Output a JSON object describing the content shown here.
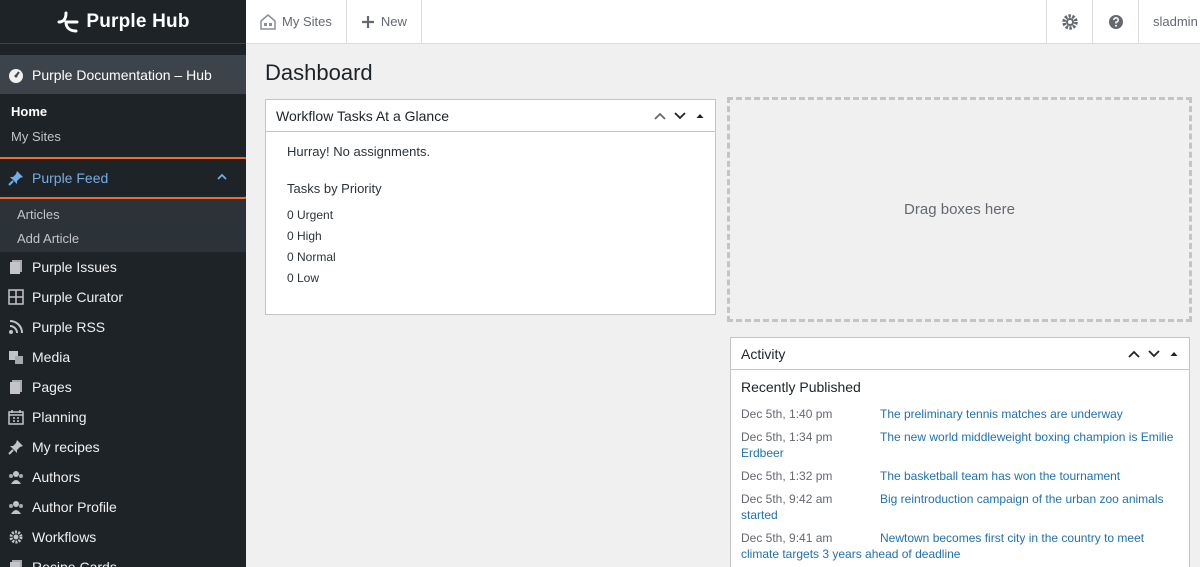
{
  "brand": {
    "name": "Purple Hub"
  },
  "sidebar": {
    "site_label": "Purple Documentation – Hub",
    "site_links": [
      {
        "label": "Home"
      },
      {
        "label": "My Sites"
      }
    ],
    "active_menu": {
      "label": "Purple Feed",
      "icon": "pin-icon"
    },
    "active_submenu": [
      {
        "label": "Articles"
      },
      {
        "label": "Add Article"
      }
    ],
    "items": [
      {
        "label": "Purple Issues",
        "icon": "issues-icon"
      },
      {
        "label": "Purple Curator",
        "icon": "curator-icon"
      },
      {
        "label": "Purple RSS",
        "icon": "rss-icon"
      },
      {
        "label": "Media",
        "icon": "media-icon"
      },
      {
        "label": "Pages",
        "icon": "pages-icon"
      },
      {
        "label": "Planning",
        "icon": "calendar-icon"
      },
      {
        "label": "My recipes",
        "icon": "pin-icon"
      },
      {
        "label": "Authors",
        "icon": "users-icon"
      },
      {
        "label": "Author Profile",
        "icon": "users-icon"
      },
      {
        "label": "Workflows",
        "icon": "gear-icon"
      },
      {
        "label": "Recipe Cards",
        "icon": "pages-icon"
      }
    ]
  },
  "topbar": {
    "my_sites": "My Sites",
    "new": "New",
    "user": "sladmin"
  },
  "page": {
    "title": "Dashboard"
  },
  "workflow_panel": {
    "title": "Workflow Tasks At a Glance",
    "message": "Hurray! No assignments.",
    "priority_heading": "Tasks by Priority",
    "priorities": [
      {
        "label": "0 Urgent"
      },
      {
        "label": "0 High"
      },
      {
        "label": "0 Normal"
      },
      {
        "label": "0 Low"
      }
    ]
  },
  "dropzone": {
    "label": "Drag boxes here"
  },
  "activity_panel": {
    "title": "Activity",
    "subtitle": "Recently Published",
    "rows": [
      {
        "date": "Dec 5th, 1:40 pm",
        "title": "The preliminary tennis matches are underway"
      },
      {
        "date": "Dec 5th, 1:34 pm",
        "title": "The new world middleweight boxing champion is Emilie Erdbeer"
      },
      {
        "date": "Dec 5th, 1:32 pm",
        "title": "The basketball team has won the tournament"
      },
      {
        "date": "Dec 5th, 9:42 am",
        "title": "Big reintroduction campaign of the urban zoo animals started"
      },
      {
        "date": "Dec 5th, 9:41 am",
        "title": "Newtown becomes first city in the country to meet climate targets 3 years ahead of deadline"
      }
    ]
  },
  "colors": {
    "accent": "#72aee6",
    "highlight_border": "#f06b2c",
    "sidebar_bg": "#1d2327",
    "link": "#2271b1"
  }
}
